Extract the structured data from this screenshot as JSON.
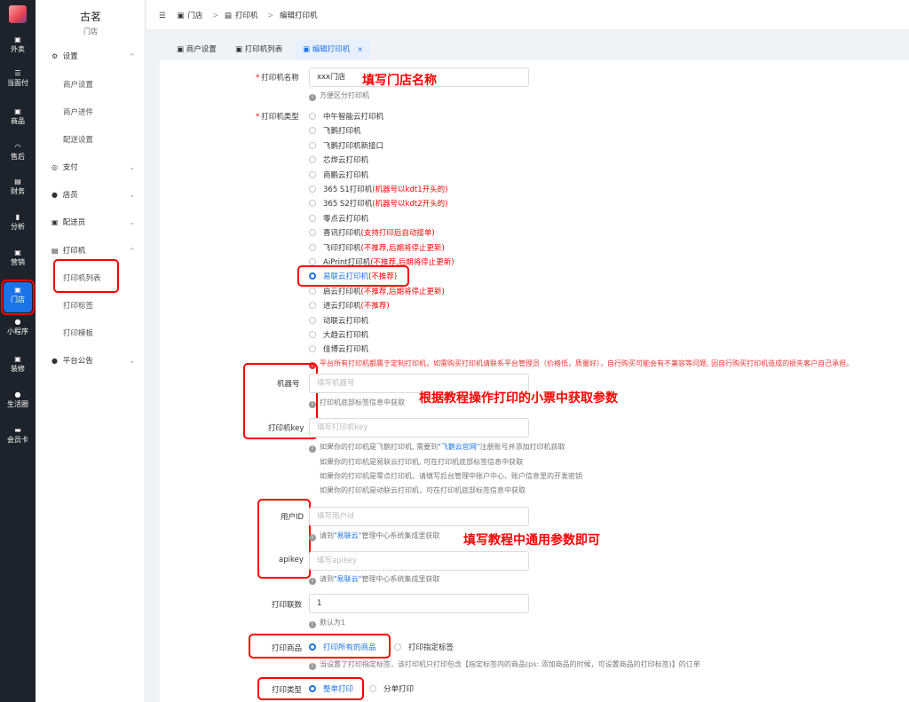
{
  "rail": {
    "items": [
      {
        "label": "外卖",
        "icon": "bag-icon"
      },
      {
        "label": "当面付",
        "icon": "list-icon"
      },
      {
        "label": "商品",
        "icon": "store-icon"
      },
      {
        "label": "售后",
        "icon": "headset-icon"
      },
      {
        "label": "财务",
        "icon": "copy-icon"
      },
      {
        "label": "分析",
        "icon": "bar-chart-icon"
      },
      {
        "label": "营销",
        "icon": "gift-icon"
      },
      {
        "label": "门店",
        "icon": "shop-icon"
      },
      {
        "label": "小程序",
        "icon": "wechat-icon"
      },
      {
        "label": "装修",
        "icon": "brush-icon"
      },
      {
        "label": "生活圈",
        "icon": "circle-icon"
      },
      {
        "label": "会员卡",
        "icon": "card-icon"
      }
    ]
  },
  "sidebar": {
    "store_name": "古茗",
    "store_sub": "门店",
    "groups": [
      {
        "label": "设置",
        "icon": "gear-icon",
        "chev": "^"
      },
      {
        "label": "支付",
        "icon": "pay-icon",
        "chev": "⌄"
      },
      {
        "label": "店员",
        "icon": "user-icon",
        "chev": "⌄"
      },
      {
        "label": "配送员",
        "icon": "delivery-icon",
        "chev": "⌄"
      },
      {
        "label": "打印机",
        "icon": "printer-icon",
        "chev": "^"
      },
      {
        "label": "平台公告",
        "icon": "notice-icon",
        "chev": "⌄"
      }
    ],
    "sub_settings": [
      "商户设置",
      "商户进件",
      "配送设置"
    ],
    "sub_printer": [
      "打印机列表",
      "打印标签",
      "打印模板"
    ]
  },
  "topbar": {
    "breadcrumb": [
      "门店",
      "打印机",
      "编辑打印机"
    ],
    "sep": ">"
  },
  "tabs": [
    {
      "label": "商户设置"
    },
    {
      "label": "打印机列表"
    },
    {
      "label": "编辑打印机",
      "close": "×"
    }
  ],
  "form": {
    "name_label": "打印机名称",
    "name_value": "xxx门店",
    "name_hint": "方便区分打印机",
    "type_label": "打印机类型",
    "types": [
      {
        "label": "中午智能云打印机",
        "note": ""
      },
      {
        "label": "飞鹅打印机",
        "note": ""
      },
      {
        "label": "飞鹅打印机新接口",
        "note": ""
      },
      {
        "label": "芯烨云打印机",
        "note": ""
      },
      {
        "label": "商鹏云打印机",
        "note": ""
      },
      {
        "label": "365 S1打印机",
        "note": "(机器号以kdt1开头的)"
      },
      {
        "label": "365 S2打印机",
        "note": "(机器号以kdt2开头的)"
      },
      {
        "label": "零点云打印机",
        "note": ""
      },
      {
        "label": "喜讯打印机",
        "note": "(支持打印后自动接单)"
      },
      {
        "label": "飞印打印机",
        "note": "(不推荐,后期将停止更新)"
      },
      {
        "label": "AiPrint打印机",
        "note": "(不推荐,后期将停止更新)"
      },
      {
        "label": "易联云打印机",
        "note": "(不推荐)"
      },
      {
        "label": "启云打印机",
        "note": "(不推荐,后期将停止更新)"
      },
      {
        "label": "进云打印机",
        "note": "(不推荐)"
      },
      {
        "label": "动联云打印机",
        "note": ""
      },
      {
        "label": "大趋云打印机",
        "note": ""
      },
      {
        "label": "佳博云打印机",
        "note": ""
      }
    ],
    "type_warning": "平台所有打印机都属于定制打印机，如需购买打印机请联系平台管理员（价格低，质量好），自行购买可能会有不兼容等问题, 因自行购买打印机造成的损失客户自己承担。",
    "machine_label": "机器号",
    "machine_placeholder": "填写机器号",
    "machine_hint": "打印机底部标签信息中获取",
    "key_label": "打印机key",
    "key_placeholder": "填写打印机key",
    "key_hints": [
      "如果你的打印机是飞鹅打印机, 需要到",
      "\"飞鹅云官网\"",
      "注册账号并添加打印机获取",
      "如果你的打印机是易联云打印机, 可在打印机底部标签信息中获取",
      "如果你的打印机是零点打印机，请填写后台管理中账户中心、账户信息里的开发密钥",
      "如果你的打印机是动联云打印机，可在打印机底部标签信息中获取"
    ],
    "userid_label": "用户ID",
    "userid_placeholder": "填写用户id",
    "userid_hint_pre": "请到",
    "userid_hint_link": "\"易联云\"",
    "userid_hint_post": "管理中心系统集成里获取",
    "apikey_label": "apikey",
    "apikey_placeholder": "填写apikey",
    "apikey_hint_pre": "请到",
    "apikey_hint_link": "\"易联云\"",
    "apikey_hint_post": "管理中心系统集成里获取",
    "copies_label": "打印联数",
    "copies_value": "1",
    "copies_hint": "默认为1",
    "goods_label": "打印商品",
    "goods_opt1": "打印所有的商品",
    "goods_opt2": "打印指定标签",
    "goods_hint": "当设置了打印指定标签，该打印机只打印包含【指定标签内的商品(ps: 添加商品的时候，可设置商品的打印标签)】的订单",
    "ptype_label": "打印类型",
    "ptype_opt1": "整单打印",
    "ptype_opt2": "分单打印"
  },
  "annotations": {
    "a1": "填写门店名称",
    "a2": "根据教程操作打印的小票中获取参数",
    "a3": "填写教程中通用参数即可"
  },
  "colors": {
    "accent": "#1a73e8",
    "rail_bg": "#1d222b",
    "annotation": "#ff0000"
  }
}
